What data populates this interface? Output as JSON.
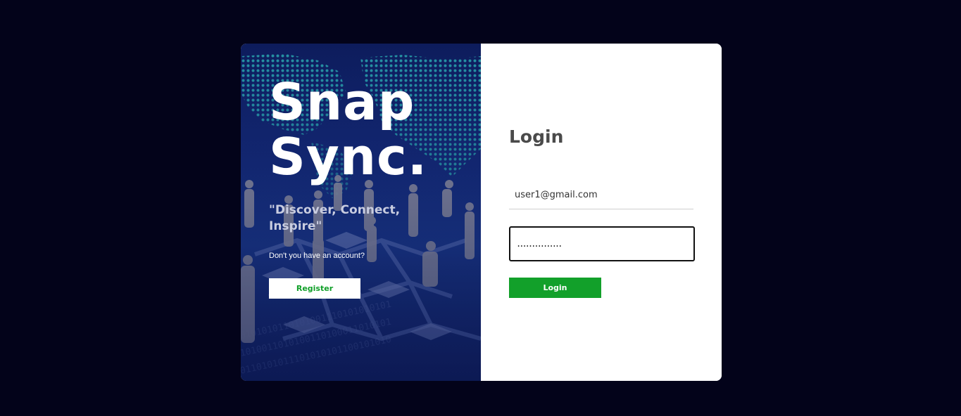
{
  "branding": {
    "title_line1": "Snap",
    "title_line2": "Sync.",
    "tagline": "\"Discover, Connect, Inspire\"",
    "register_prompt": "Don't you have an account?",
    "register_label": "Register"
  },
  "login": {
    "title": "Login",
    "email_value": "user1@gmail.com",
    "password_mask": "...............",
    "submit_label": "Login"
  },
  "colors": {
    "page_background": "#03031a",
    "accent_green": "#12a02a",
    "panel_white": "#ffffff"
  },
  "icons": [
    "world-map-illustration",
    "people-network-illustration"
  ]
}
